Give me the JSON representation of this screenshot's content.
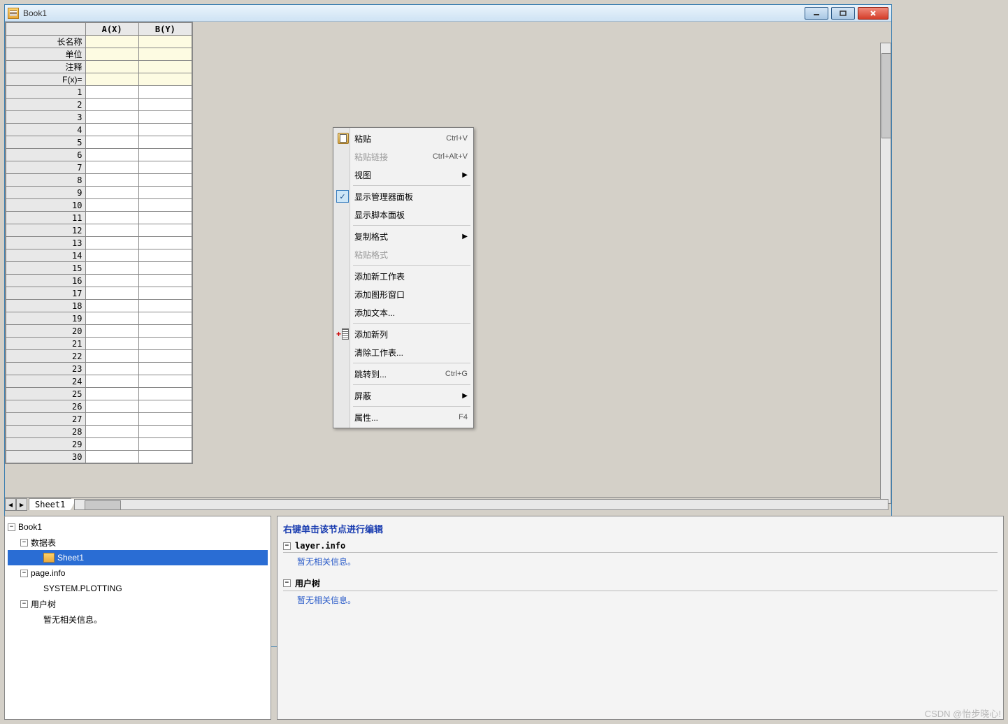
{
  "window": {
    "title": "Book1"
  },
  "columns": [
    "A(X)",
    "B(Y)"
  ],
  "metaRows": [
    "长名称",
    "单位",
    "注释",
    "F(x)="
  ],
  "rowCount": 30,
  "sheetTab": "Sheet1",
  "contextMenu": [
    {
      "type": "item",
      "label": "粘贴",
      "shortcut": "Ctrl+V",
      "icon": "paste"
    },
    {
      "type": "item",
      "label": "粘贴链接",
      "shortcut": "Ctrl+Alt+V",
      "disabled": true
    },
    {
      "type": "item",
      "label": "视图",
      "submenu": true
    },
    {
      "type": "sep"
    },
    {
      "type": "item",
      "label": "显示管理器面板",
      "checked": true
    },
    {
      "type": "item",
      "label": "显示脚本面板"
    },
    {
      "type": "sep"
    },
    {
      "type": "item",
      "label": "复制格式",
      "submenu": true
    },
    {
      "type": "item",
      "label": "粘贴格式",
      "disabled": true
    },
    {
      "type": "sep"
    },
    {
      "type": "item",
      "label": "添加新工作表"
    },
    {
      "type": "item",
      "label": "添加图形窗口"
    },
    {
      "type": "item",
      "label": "添加文本..."
    },
    {
      "type": "sep"
    },
    {
      "type": "item",
      "label": "添加新列",
      "icon": "addcol"
    },
    {
      "type": "item",
      "label": "清除工作表..."
    },
    {
      "type": "sep"
    },
    {
      "type": "item",
      "label": "跳转到...",
      "shortcut": "Ctrl+G"
    },
    {
      "type": "sep"
    },
    {
      "type": "item",
      "label": "屏蔽",
      "submenu": true
    },
    {
      "type": "sep"
    },
    {
      "type": "item",
      "label": "属性...",
      "shortcut": "F4"
    }
  ],
  "tree": {
    "root": "Book1",
    "nodes": [
      {
        "label": "数据表",
        "indent": 1,
        "expanded": true
      },
      {
        "label": "Sheet1",
        "indent": 2,
        "selected": true,
        "icon": true
      },
      {
        "label": "page.info",
        "indent": 1,
        "expanded": true
      },
      {
        "label": "SYSTEM.PLOTTING",
        "indent": 2
      },
      {
        "label": "用户树",
        "indent": 1,
        "expanded": true
      },
      {
        "label": "暂无相关信息。",
        "indent": 2
      }
    ]
  },
  "infoPanel": {
    "title": "右键单击该节点进行编辑",
    "sections": [
      {
        "head": "layer.info",
        "text": "暂无相关信息。"
      },
      {
        "head": "用户树",
        "text": "暂无相关信息。"
      }
    ]
  },
  "watermark": "CSDN @怡步晓心!"
}
